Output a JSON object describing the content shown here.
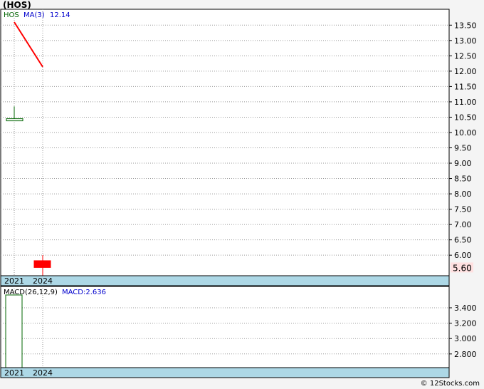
{
  "title": "(HOS)",
  "footer": "© 12Stocks.com",
  "chart_data": [
    {
      "type": "candlestick",
      "legend": {
        "ticker": "HOS",
        "ma_label": "MA(3)",
        "ma_value": "12.14"
      },
      "x_labels": [
        "2021",
        "2024"
      ],
      "y_ticks": [
        13.5,
        13.0,
        12.5,
        12.0,
        11.5,
        11.0,
        10.5,
        10.0,
        9.5,
        9.0,
        8.5,
        8.0,
        7.5,
        7.0,
        6.5,
        6.0
      ],
      "y_tick_labels": [
        "13.50",
        "13.00",
        "12.50",
        "12.00",
        "11.50",
        "11.00",
        "10.50",
        "10.00",
        "9.50",
        "9.00",
        "8.50",
        "8.00",
        "7.50",
        "7.00",
        "6.50",
        "6.00"
      ],
      "last_price_label": "5.60",
      "colors": {
        "up": "#006400",
        "down": "#ff0000",
        "ma": "#ff0000",
        "last_price_bg": "#ffe0e0",
        "axis_band": "#add8e6"
      },
      "candles": [
        {
          "x": "2021",
          "open": 10.42,
          "high": 10.85,
          "low": 10.42,
          "close": 10.45
        },
        {
          "x": "2024",
          "open": 5.82,
          "high": 6.0,
          "low": 5.3,
          "close": 5.6
        }
      ],
      "ma": [
        {
          "x": "2021",
          "value": 13.6
        },
        {
          "x": "2024",
          "value": 12.14
        }
      ],
      "grid": true
    },
    {
      "type": "bar",
      "legend": {
        "label": "MACD(26,12,9)",
        "value_label": "MACD:2.636"
      },
      "x_labels": [
        "2021",
        "2024"
      ],
      "y_ticks": [
        3.4,
        3.2,
        3.0,
        2.8
      ],
      "y_tick_labels": [
        "3.400",
        "3.200",
        "3.000",
        "2.800"
      ],
      "colors": {
        "bar_stroke": "#006400",
        "bar_fill": "#ffffff",
        "axis_band": "#add8e6"
      },
      "bars": [
        {
          "x": "2021",
          "value": 3.57
        }
      ],
      "grid": true
    }
  ]
}
